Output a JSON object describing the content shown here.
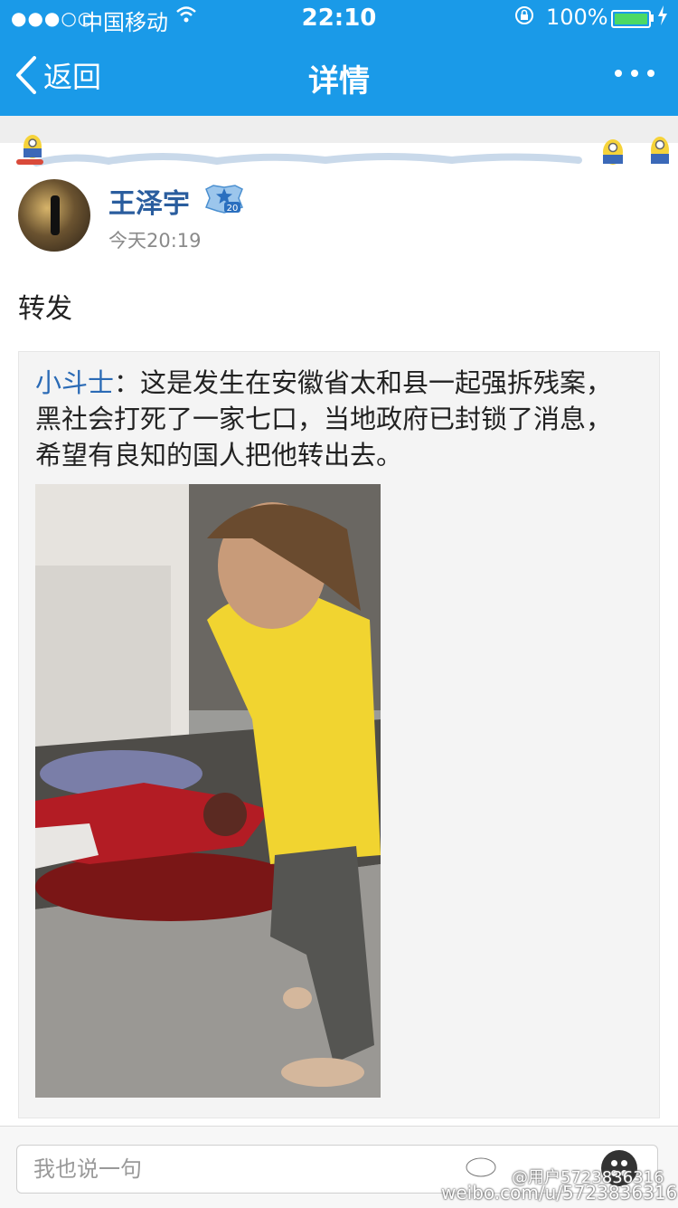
{
  "status_bar": {
    "signal": "●●●○○",
    "carrier": "中国移动",
    "time": "22:10",
    "battery": "100%"
  },
  "nav": {
    "back_label": "返回",
    "title": "详情"
  },
  "post": {
    "author": "王泽宇",
    "badge_level": "20",
    "timestamp": "今天20:19",
    "text": "转发"
  },
  "repost": {
    "author": "小斗士",
    "separator": "：",
    "text": "这是发生在安徽省太和县一起强拆残案，黑社会打死了一家七口，当地政府已封锁了消息，希望有良知的国人把他转出去。"
  },
  "comment_bar": {
    "placeholder": "我也说一句"
  },
  "watermark": {
    "handle": "@用户5723836316",
    "url": "weibo.com/u/5723836316"
  },
  "colors": {
    "brand": "#1a9ae8",
    "author": "#2a5d9e",
    "repost_author": "#2a6ab5"
  }
}
